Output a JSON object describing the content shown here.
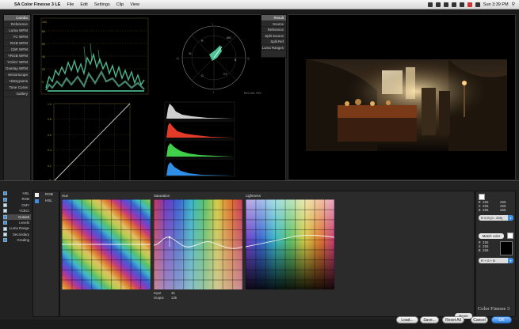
{
  "menubar": {
    "app_name": "SA Color Finesse 3 LE",
    "menus": [
      "File",
      "Edit",
      "Settings",
      "Clip",
      "View"
    ],
    "clock": "Sun 3:39 PM"
  },
  "scope_modes": {
    "items": [
      "Combo",
      "Reference",
      "Luma WFM",
      "YC WFM",
      "RGB WFM",
      "CbR WFM",
      "YRGB WFM",
      "YCbCr WFM",
      "Overlay WFM",
      "Vectorscope",
      "Histograms",
      "Tone Curve",
      "Gallery"
    ],
    "selected": "Combo"
  },
  "viewer_modes": {
    "items": [
      "Result",
      "Source",
      "Reference",
      "Split Source",
      "Split Ref",
      "Luma Ranges"
    ],
    "selected": "Result"
  },
  "scopes": {
    "waveform_labels": [
      "100",
      "80",
      "60",
      "40",
      "20",
      "0"
    ],
    "curve_labels": [
      "1.0",
      "0.8",
      "0.6",
      "0.4",
      "0.2",
      "0"
    ],
    "vector_labels": [
      "R",
      "YL",
      "G",
      "CY",
      "B",
      "MG",
      "I",
      "-I",
      "Q",
      "-Q"
    ],
    "vector_note": "REC 601 75%"
  },
  "transport": {
    "timecode": "00:00:00:00"
  },
  "tools": {
    "items": [
      {
        "label": "HSL",
        "on": true
      },
      {
        "label": "RGB",
        "on": true
      },
      {
        "label": "CMY",
        "on": false
      },
      {
        "label": "YCbCr",
        "on": false
      },
      {
        "label": "Curves",
        "on": true
      },
      {
        "label": "Levels",
        "on": true
      },
      {
        "label": "Luma Range",
        "on": false
      },
      {
        "label": "Secondary",
        "on": false
      },
      {
        "label": "Grading",
        "on": true
      }
    ],
    "selected": "Curves"
  },
  "color_channels": {
    "items": [
      {
        "label": "RGB",
        "on": false
      },
      {
        "label": "HSL",
        "on": true
      }
    ]
  },
  "curves": {
    "hue_title": "Hue",
    "sat_title": "Saturation",
    "light_title": "Lightness",
    "info_labels": [
      "Input",
      "Output"
    ],
    "info_values": [
      "45",
      "135"
    ],
    "reset_label": "Reset"
  },
  "right_panel": {
    "top_rgb": [
      [
        "R",
        "255"
      ],
      [
        "G",
        "255"
      ],
      [
        "B",
        "255"
      ]
    ],
    "top_rgb_right": [
      [
        "255"
      ],
      [
        "255"
      ],
      [
        "255"
      ]
    ],
    "mode_select": "R G B (0 - 255)",
    "match_color_label": "Match color",
    "bottom_rgb": [
      [
        "R",
        "255"
      ],
      [
        "G",
        "255"
      ],
      [
        "B",
        "255"
      ]
    ],
    "bottom_select": "R + G + B",
    "logo": "Color Finesse 3"
  },
  "footer": {
    "load": "Load...",
    "save": "Save...",
    "reset_all": "Reset All",
    "cancel": "Cancel",
    "ok": "OK"
  },
  "colors": {
    "accent": "#2a7fe0",
    "waveform": "#5fe0b0",
    "hist_white": "#cfcfcf",
    "hist_red": "#e23b2a",
    "hist_green": "#3fcf4a",
    "hist_blue": "#2f8fe6"
  }
}
